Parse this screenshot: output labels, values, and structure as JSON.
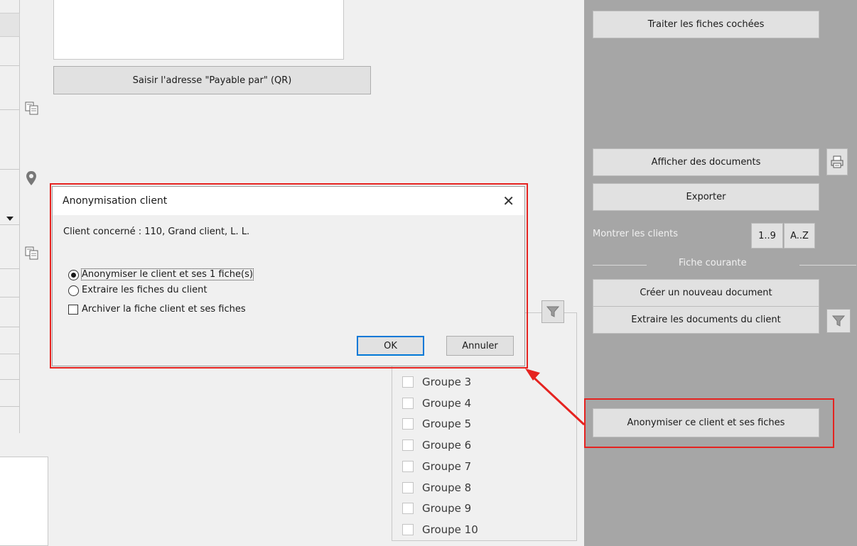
{
  "main": {
    "payable_button_label": "Saisir l'adresse \"Payable par\" (QR)"
  },
  "right_panel": {
    "process_checked_label": "Traiter les fiches cochées",
    "show_documents_label": "Afficher des documents",
    "export_label": "Exporter",
    "show_clients_label": "Montrer les clients",
    "sort_numeric_label": "1..9",
    "sort_alpha_label": "A..Z",
    "current_record_label": "Fiche courante",
    "new_document_label": "Créer un nouveau document",
    "extract_documents_label": "Extraire les documents du client",
    "anonymize_button_label": "Anonymiser ce client et ses fiches"
  },
  "groups": [
    {
      "label": "Groupe 3",
      "checked": false
    },
    {
      "label": "Groupe 4",
      "checked": false
    },
    {
      "label": "Groupe 5",
      "checked": false
    },
    {
      "label": "Groupe 6",
      "checked": false
    },
    {
      "label": "Groupe 7",
      "checked": false
    },
    {
      "label": "Groupe 8",
      "checked": false
    },
    {
      "label": "Groupe 9",
      "checked": false
    },
    {
      "label": "Groupe 10",
      "checked": false
    }
  ],
  "dialog": {
    "title": "Anonymisation client",
    "client_info": "Client concerné : 110, Grand client, L. L.",
    "option_anonymize": "Anonymiser le client et ses 1 fiche(s)",
    "option_extract": "Extraire les fiches du client",
    "archive_label": "Archiver la fiche client et ses fiches",
    "ok_label": "OK",
    "cancel_label": "Annuler",
    "selected_option": "anonymize",
    "archive_checked": false
  },
  "colors": {
    "highlight": "#e52320",
    "panel": "#a6a6a6",
    "focus_border": "#0078d7"
  }
}
